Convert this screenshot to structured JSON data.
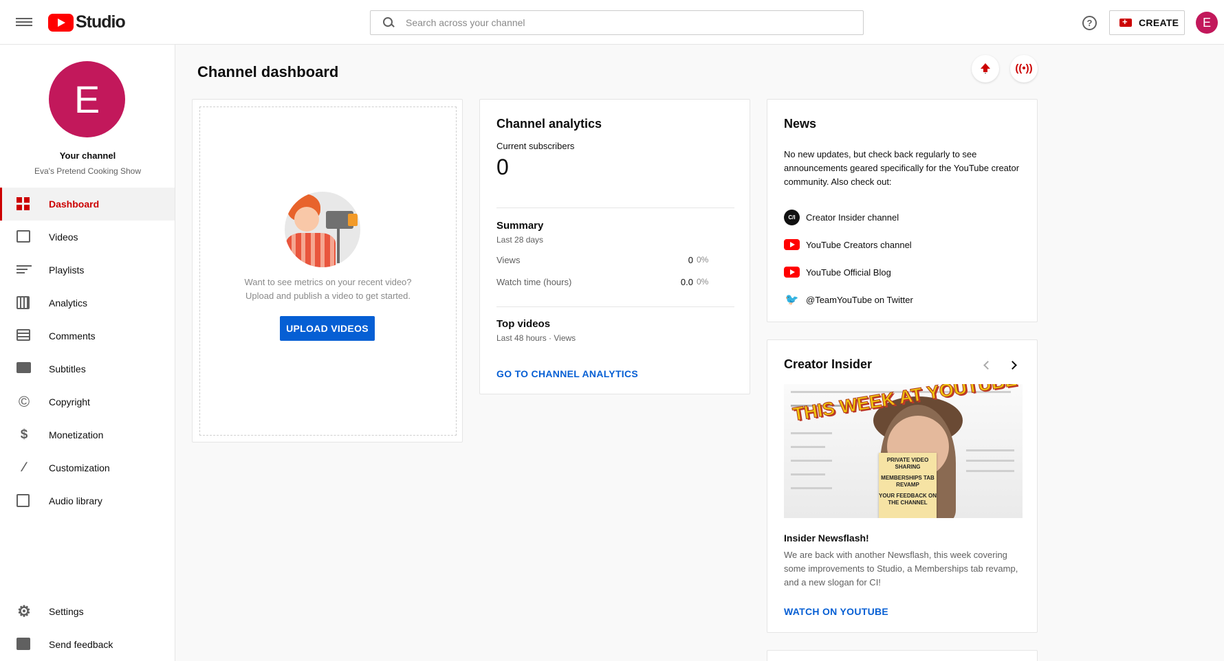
{
  "header": {
    "logo_text": "Studio",
    "search_placeholder": "Search across your channel",
    "create_label": "CREATE",
    "avatar_letter": "E"
  },
  "sidebar": {
    "avatar_letter": "E",
    "channel_title": "Your channel",
    "channel_name": "Eva's Pretend Cooking Show",
    "items": [
      {
        "label": "Dashboard",
        "icon": "dashboard-icon",
        "active": true
      },
      {
        "label": "Videos",
        "icon": "videos-icon"
      },
      {
        "label": "Playlists",
        "icon": "playlists-icon"
      },
      {
        "label": "Analytics",
        "icon": "analytics-icon"
      },
      {
        "label": "Comments",
        "icon": "comments-icon"
      },
      {
        "label": "Subtitles",
        "icon": "subtitles-icon"
      },
      {
        "label": "Copyright",
        "icon": "copyright-icon"
      },
      {
        "label": "Monetization",
        "icon": "monetization-icon"
      },
      {
        "label": "Customization",
        "icon": "customization-icon"
      },
      {
        "label": "Audio library",
        "icon": "audio-library-icon"
      }
    ],
    "bottom_items": [
      {
        "label": "Settings",
        "icon": "settings-icon"
      },
      {
        "label": "Send feedback",
        "icon": "feedback-icon"
      }
    ]
  },
  "main": {
    "title": "Channel dashboard",
    "upload_card": {
      "help_line1": "Want to see metrics on your recent video?",
      "help_line2": "Upload and publish a video to get started.",
      "button_label": "UPLOAD VIDEOS"
    },
    "analytics_card": {
      "title": "Channel analytics",
      "subscribers_label": "Current subscribers",
      "subscribers_value": "0",
      "summary_title": "Summary",
      "summary_period": "Last 28 days",
      "rows": [
        {
          "label": "Views",
          "value": "0",
          "change": "0%"
        },
        {
          "label": "Watch time (hours)",
          "value": "0.0",
          "change": "0%"
        }
      ],
      "top_videos_title": "Top videos",
      "top_videos_period": "Last 48 hours · Views",
      "link_label": "GO TO CHANNEL ANALYTICS"
    },
    "news_card": {
      "title": "News",
      "text": "No new updates, but check back regularly to see announcements geared specifically for the YouTube creator community. Also check out:",
      "links": [
        {
          "label": "Creator Insider channel",
          "icon": "creator-insider-icon",
          "badge": "C/I"
        },
        {
          "label": "YouTube Creators channel",
          "icon": "youtube-icon"
        },
        {
          "label": "YouTube Official Blog",
          "icon": "youtube-icon"
        },
        {
          "label": "@TeamYouTube on Twitter",
          "icon": "twitter-icon"
        }
      ]
    },
    "insider_card": {
      "title": "Creator Insider",
      "thumbnail_banner": "THIS WEEK AT YOUTUBE",
      "thumbnail_note": [
        "PRIVATE VIDEO SHARING",
        "MEMBERSHIPS TAB REVAMP",
        "YOUR FEEDBACK ON THE CHANNEL"
      ],
      "video_title": "Insider Newsflash!",
      "video_desc": "We are back with another Newsflash, this week covering some improvements to Studio, a Memberships tab revamp, and a new slogan for CI!",
      "link_label": "WATCH ON YOUTUBE"
    }
  },
  "colors": {
    "brand_red": "#ff0000",
    "accent_red": "#cc0000",
    "link_blue": "#065fd4",
    "avatar_pink": "#c2185b"
  }
}
